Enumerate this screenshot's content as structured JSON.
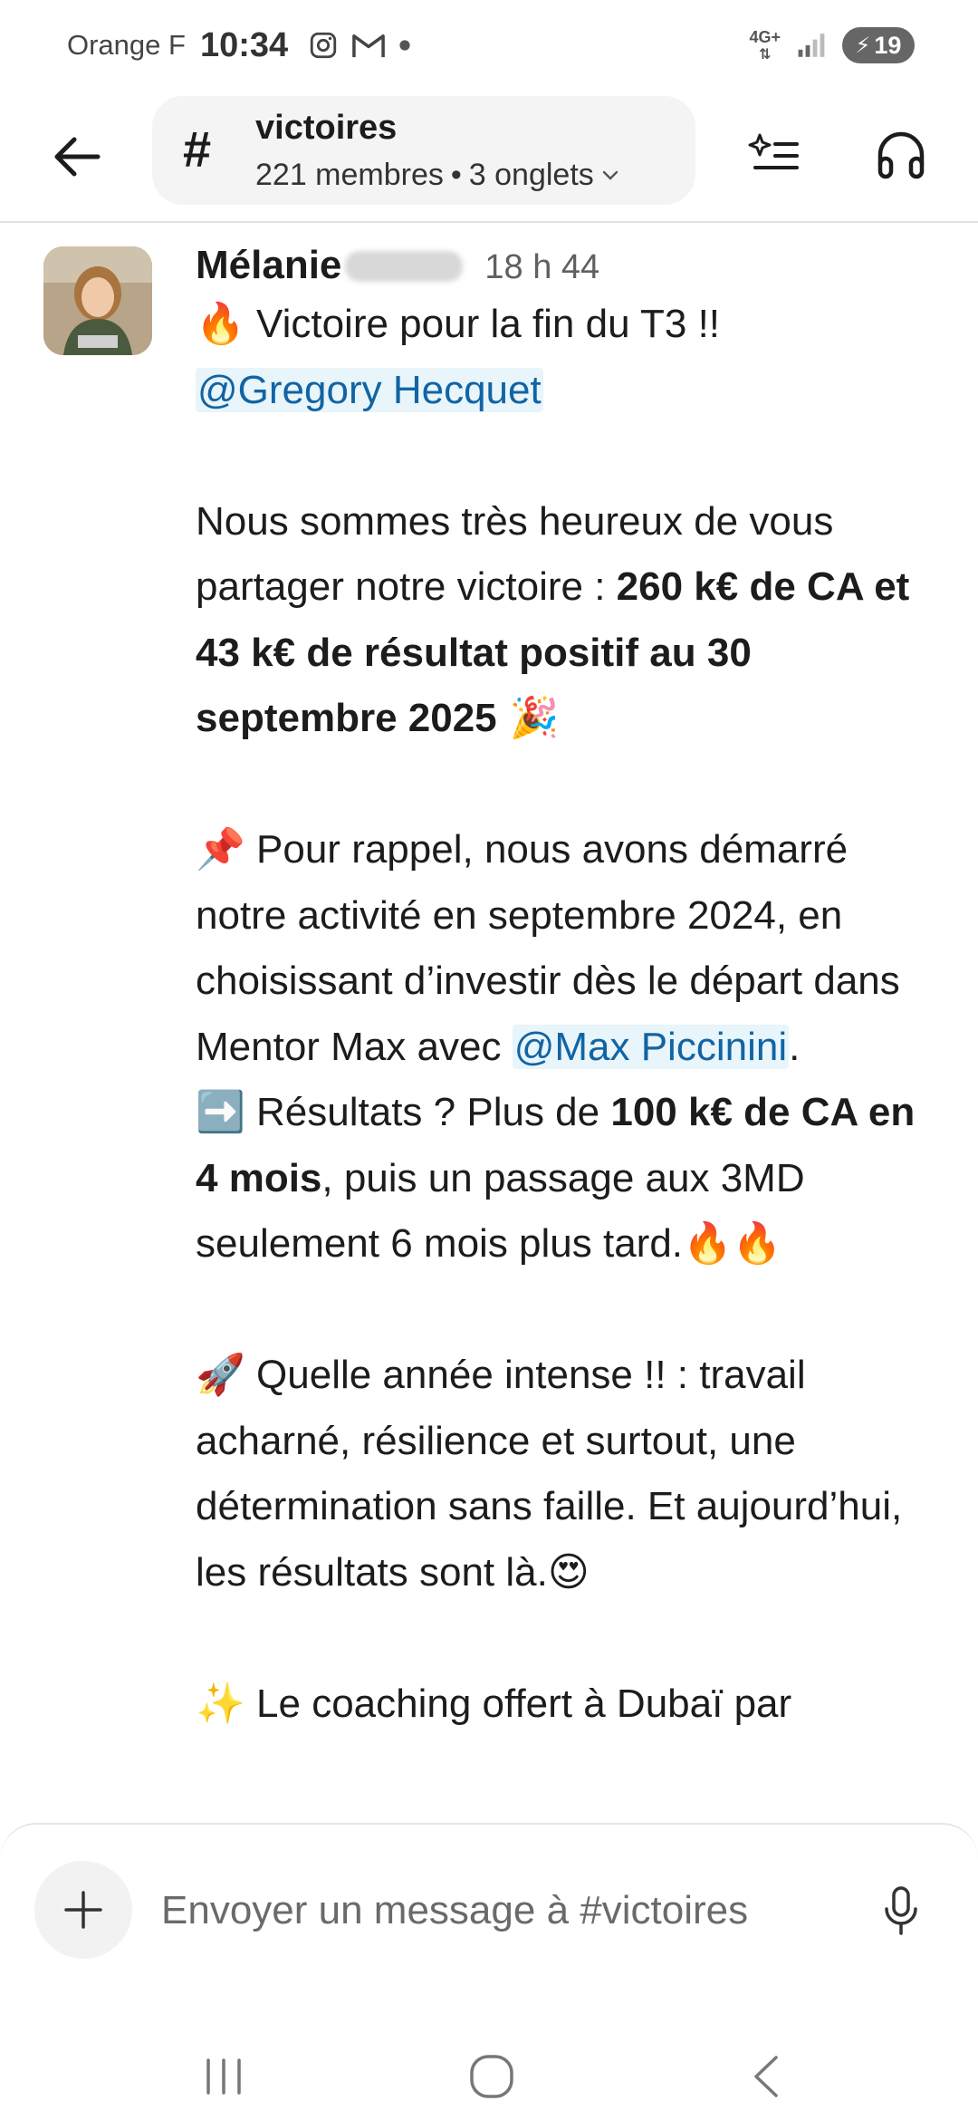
{
  "status_bar": {
    "carrier": "Orange F",
    "time": "10:34",
    "network": "4G+",
    "battery": "19"
  },
  "header": {
    "channel_hash": "#",
    "channel_name": "victoires",
    "members": "221 membres",
    "separator": "•",
    "tabs": "3 onglets"
  },
  "message": {
    "author": "Mélanie",
    "time": "18 h 44",
    "lines": {
      "l1_emoji": "🔥",
      "l1_text": " Victoire pour la fin du T3 !!",
      "mention_gregory": "@Gregory Hecquet",
      "p2_a": "Nous sommes très heureux de vous partager notre victoire : ",
      "p2_bold": "260 k€ de CA et 43 k€ de résultat positif au 30 septembre 2025",
      "p2_emoji": " 🎉",
      "p3_emoji": "📌",
      "p3_a": " Pour rappel, nous avons démarré notre activité en septembre 2024, en choisissant d’investir dès le départ dans Mentor Max avec ",
      "mention_max": "@Max Piccinini",
      "p3_end": ".",
      "p4_emoji": "➡️",
      "p4_a": " Résultats ? Plus de ",
      "p4_bold": "100 k€ de CA en 4 mois",
      "p4_b": ", puis un passage aux 3MD seulement 6 mois plus tard.",
      "p4_emoji_end": "🔥🔥",
      "p5_emoji": "🚀",
      "p5_a": " Quelle année intense !! : travail acharné, résilience et surtout, une détermination sans faille. Et aujourd’hui, les résultats sont là.",
      "p5_emoji_end": "😍",
      "p6_emoji": "✨",
      "p6_a": " Le coaching offert à Dubaï par"
    }
  },
  "composer": {
    "placeholder": "Envoyer un message à #victoires"
  },
  "icons": {
    "back": "arrow-left-icon",
    "ai": "sparkle-list-icon",
    "huddle": "headphones-icon",
    "plus": "plus-icon",
    "mic": "microphone-icon"
  }
}
